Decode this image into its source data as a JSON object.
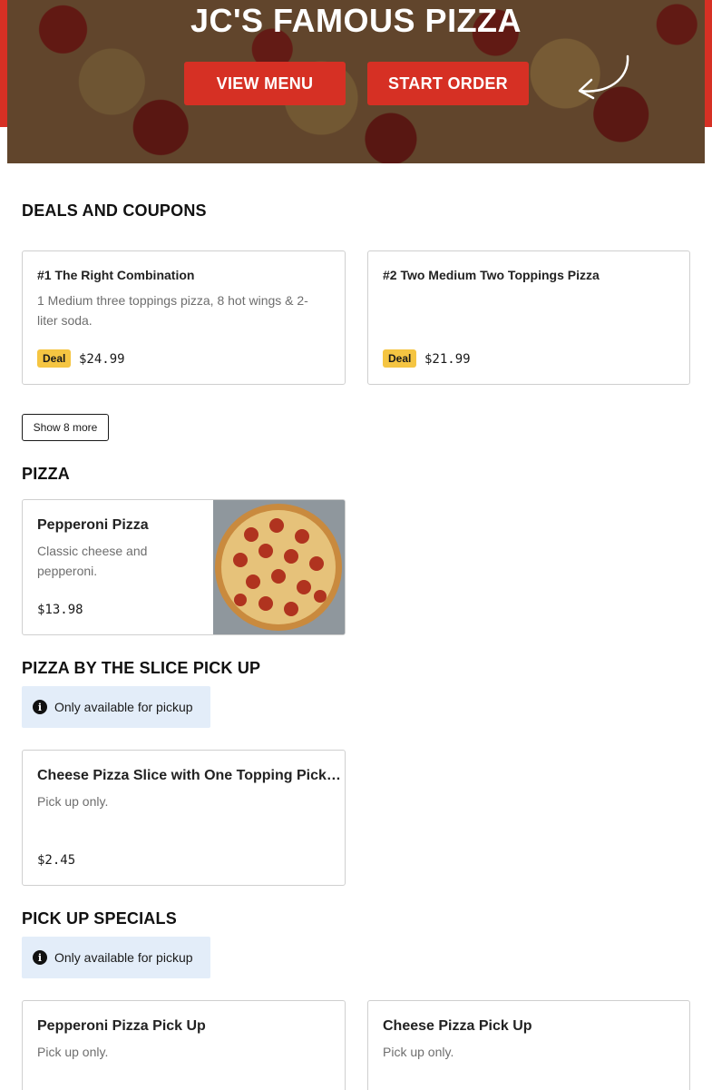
{
  "hero": {
    "title": "JC'S FAMOUS PIZZA",
    "view_menu_label": "VIEW MENU",
    "start_order_label": "START ORDER",
    "arrow_icon": "curved-arrow-icon"
  },
  "deals": {
    "title": "DEALS AND COUPONS",
    "items": [
      {
        "name": "#1 The Right Combination",
        "description": "1 Medium three toppings pizza, 8 hot wings & 2-liter soda.",
        "badge": "Deal",
        "price": "$24.99"
      },
      {
        "name": "#2 Two Medium Two Toppings Pizza",
        "description": "",
        "badge": "Deal",
        "price": "$21.99"
      }
    ],
    "show_more_label": "Show 8 more"
  },
  "pizza": {
    "title": "PIZZA",
    "items": [
      {
        "name": "Pepperoni Pizza",
        "description": "Classic cheese and pepperoni.",
        "price": "$13.98"
      }
    ]
  },
  "slice": {
    "title": "PIZZA BY THE SLICE PICK UP",
    "note": "Only available for pickup",
    "items": [
      {
        "name": "Cheese Pizza Slice with One Topping Pick…",
        "description": "Pick up only.",
        "price": "$2.45"
      }
    ]
  },
  "specials": {
    "title": "PICK UP SPECIALS",
    "note": "Only available for pickup",
    "items": [
      {
        "name": "Pepperoni Pizza Pick Up",
        "description": "Pick up only."
      },
      {
        "name": "Cheese Pizza Pick Up",
        "description": "Pick up only."
      }
    ]
  },
  "colors": {
    "brand_red": "#d63024",
    "deal_yellow": "#f5c542",
    "note_blue": "#e3edf9"
  }
}
